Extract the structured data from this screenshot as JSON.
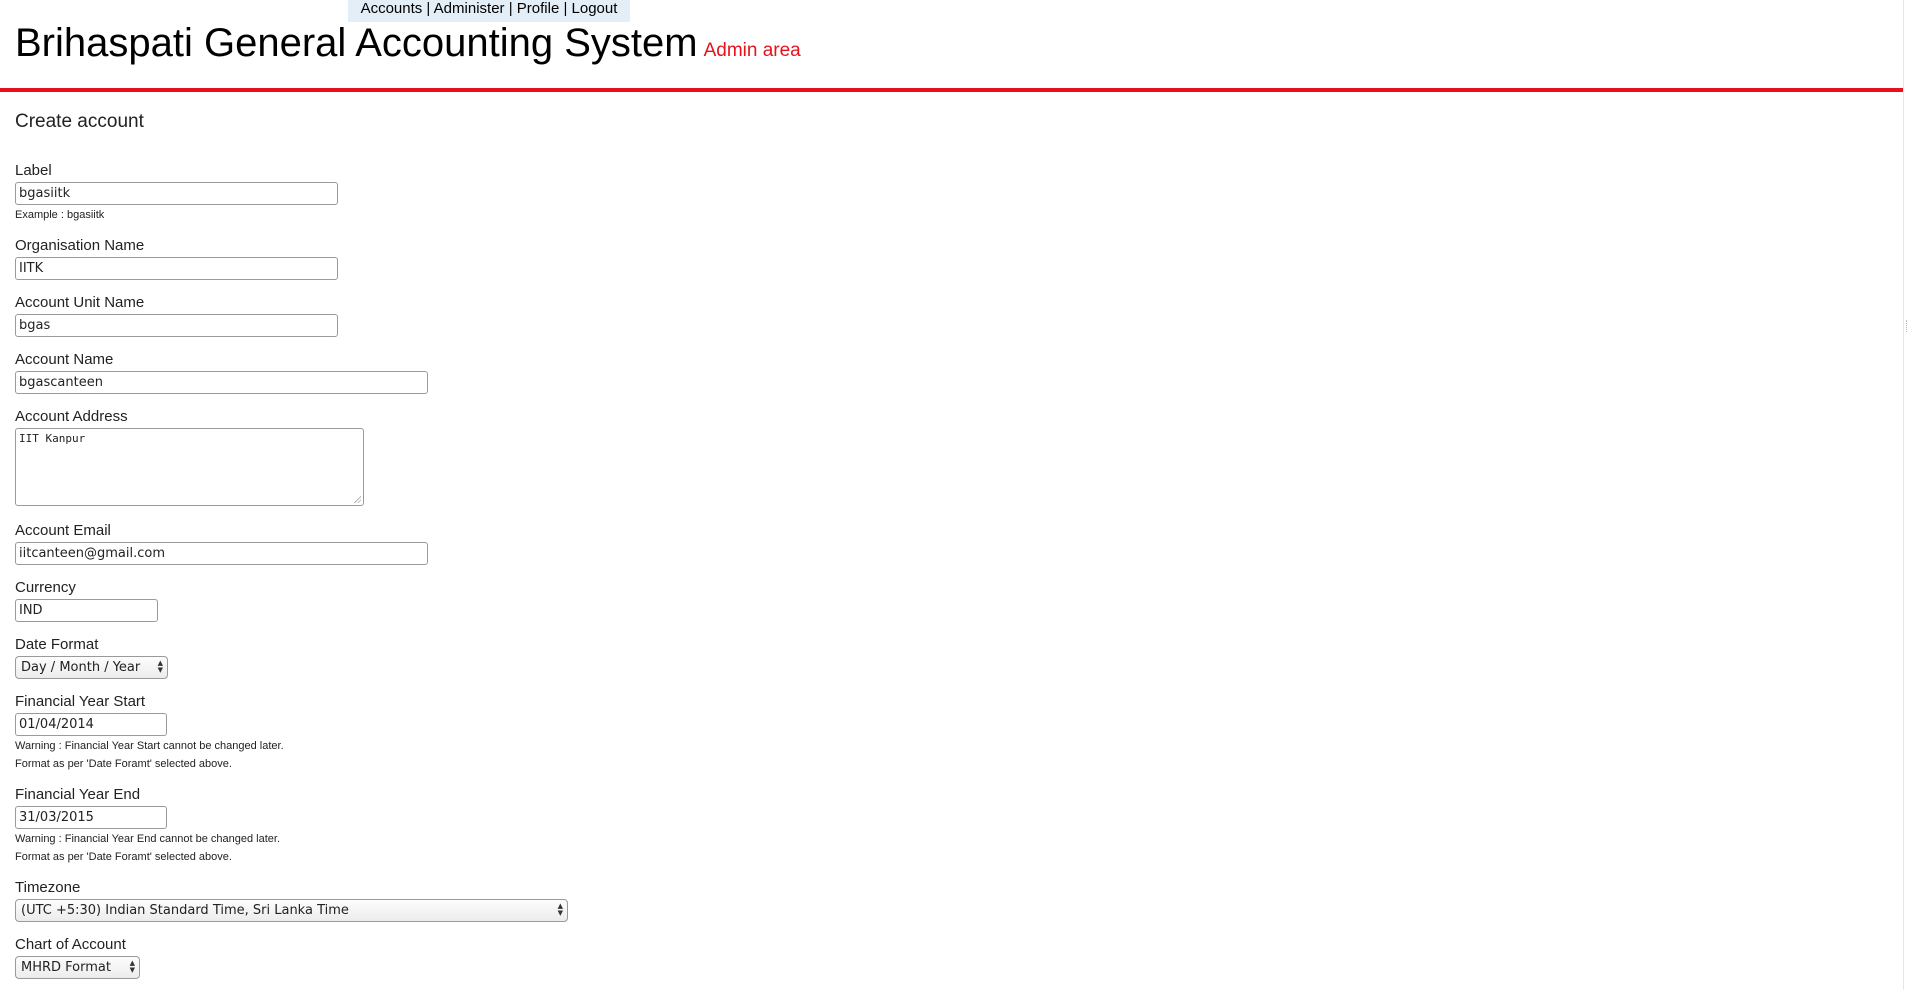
{
  "topnav": {
    "accounts": "Accounts",
    "administer": "Administer",
    "profile": "Profile",
    "logout": "Logout",
    "separator": " | "
  },
  "header": {
    "title": "Brihaspati General Accounting System",
    "subtitle": "Admin area"
  },
  "form": {
    "heading": "Create account",
    "label": {
      "label": "Label",
      "value": "bgasiitk",
      "hint": "Example : bgasiitk"
    },
    "org_name": {
      "label": "Organisation Name",
      "value": "IITK"
    },
    "unit_name": {
      "label": "Account Unit Name",
      "value": "bgas"
    },
    "account_name": {
      "label": "Account Name",
      "value": "bgascanteen"
    },
    "address": {
      "label": "Account Address",
      "value": "IIT Kanpur"
    },
    "email": {
      "label": "Account Email",
      "value": "iitcanteen@gmail.com"
    },
    "currency": {
      "label": "Currency",
      "value": "IND"
    },
    "date_format": {
      "label": "Date Format",
      "value": "Day / Month / Year"
    },
    "fy_start": {
      "label": "Financial Year Start",
      "value": "01/04/2014",
      "warning": "Warning : Financial Year Start cannot be changed later.",
      "format_note": "Format as per 'Date Foramt' selected above."
    },
    "fy_end": {
      "label": "Financial Year End",
      "value": "31/03/2015",
      "warning": "Warning : Financial Year End cannot be changed later.",
      "format_note": "Format as per 'Date Foramt' selected above."
    },
    "timezone": {
      "label": "Timezone",
      "value": "(UTC +5:30) Indian Standard Time, Sri Lanka Time"
    },
    "chart_of_account": {
      "label": "Chart of Account",
      "value": "MHRD Format"
    }
  },
  "colors": {
    "accent": "#e8111b",
    "nav_bg": "#e3eef6"
  },
  "icons": {
    "select_arrows": "up-down-arrows-icon",
    "resize": "resize-grip-icon"
  }
}
